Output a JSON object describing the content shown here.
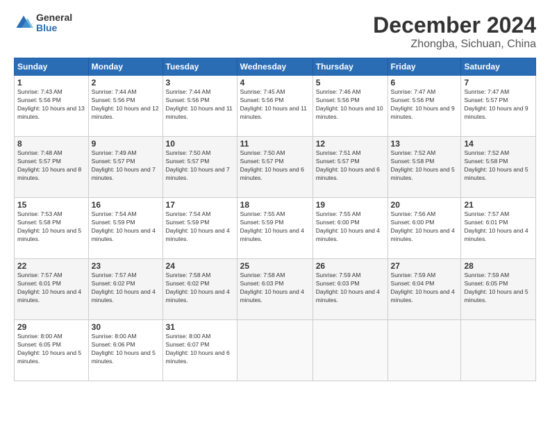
{
  "logo": {
    "general": "General",
    "blue": "Blue"
  },
  "title": "December 2024",
  "location": "Zhongba, Sichuan, China",
  "days_of_week": [
    "Sunday",
    "Monday",
    "Tuesday",
    "Wednesday",
    "Thursday",
    "Friday",
    "Saturday"
  ],
  "weeks": [
    [
      {
        "day": "1",
        "sunrise": "7:43 AM",
        "sunset": "5:56 PM",
        "daylight": "10 hours and 13 minutes."
      },
      {
        "day": "2",
        "sunrise": "7:44 AM",
        "sunset": "5:56 PM",
        "daylight": "10 hours and 12 minutes."
      },
      {
        "day": "3",
        "sunrise": "7:44 AM",
        "sunset": "5:56 PM",
        "daylight": "10 hours and 11 minutes."
      },
      {
        "day": "4",
        "sunrise": "7:45 AM",
        "sunset": "5:56 PM",
        "daylight": "10 hours and 11 minutes."
      },
      {
        "day": "5",
        "sunrise": "7:46 AM",
        "sunset": "5:56 PM",
        "daylight": "10 hours and 10 minutes."
      },
      {
        "day": "6",
        "sunrise": "7:47 AM",
        "sunset": "5:56 PM",
        "daylight": "10 hours and 9 minutes."
      },
      {
        "day": "7",
        "sunrise": "7:47 AM",
        "sunset": "5:57 PM",
        "daylight": "10 hours and 9 minutes."
      }
    ],
    [
      {
        "day": "8",
        "sunrise": "7:48 AM",
        "sunset": "5:57 PM",
        "daylight": "10 hours and 8 minutes."
      },
      {
        "day": "9",
        "sunrise": "7:49 AM",
        "sunset": "5:57 PM",
        "daylight": "10 hours and 7 minutes."
      },
      {
        "day": "10",
        "sunrise": "7:50 AM",
        "sunset": "5:57 PM",
        "daylight": "10 hours and 7 minutes."
      },
      {
        "day": "11",
        "sunrise": "7:50 AM",
        "sunset": "5:57 PM",
        "daylight": "10 hours and 6 minutes."
      },
      {
        "day": "12",
        "sunrise": "7:51 AM",
        "sunset": "5:57 PM",
        "daylight": "10 hours and 6 minutes."
      },
      {
        "day": "13",
        "sunrise": "7:52 AM",
        "sunset": "5:58 PM",
        "daylight": "10 hours and 5 minutes."
      },
      {
        "day": "14",
        "sunrise": "7:52 AM",
        "sunset": "5:58 PM",
        "daylight": "10 hours and 5 minutes."
      }
    ],
    [
      {
        "day": "15",
        "sunrise": "7:53 AM",
        "sunset": "5:58 PM",
        "daylight": "10 hours and 5 minutes."
      },
      {
        "day": "16",
        "sunrise": "7:54 AM",
        "sunset": "5:59 PM",
        "daylight": "10 hours and 4 minutes."
      },
      {
        "day": "17",
        "sunrise": "7:54 AM",
        "sunset": "5:59 PM",
        "daylight": "10 hours and 4 minutes."
      },
      {
        "day": "18",
        "sunrise": "7:55 AM",
        "sunset": "5:59 PM",
        "daylight": "10 hours and 4 minutes."
      },
      {
        "day": "19",
        "sunrise": "7:55 AM",
        "sunset": "6:00 PM",
        "daylight": "10 hours and 4 minutes."
      },
      {
        "day": "20",
        "sunrise": "7:56 AM",
        "sunset": "6:00 PM",
        "daylight": "10 hours and 4 minutes."
      },
      {
        "day": "21",
        "sunrise": "7:57 AM",
        "sunset": "6:01 PM",
        "daylight": "10 hours and 4 minutes."
      }
    ],
    [
      {
        "day": "22",
        "sunrise": "7:57 AM",
        "sunset": "6:01 PM",
        "daylight": "10 hours and 4 minutes."
      },
      {
        "day": "23",
        "sunrise": "7:57 AM",
        "sunset": "6:02 PM",
        "daylight": "10 hours and 4 minutes."
      },
      {
        "day": "24",
        "sunrise": "7:58 AM",
        "sunset": "6:02 PM",
        "daylight": "10 hours and 4 minutes."
      },
      {
        "day": "25",
        "sunrise": "7:58 AM",
        "sunset": "6:03 PM",
        "daylight": "10 hours and 4 minutes."
      },
      {
        "day": "26",
        "sunrise": "7:59 AM",
        "sunset": "6:03 PM",
        "daylight": "10 hours and 4 minutes."
      },
      {
        "day": "27",
        "sunrise": "7:59 AM",
        "sunset": "6:04 PM",
        "daylight": "10 hours and 4 minutes."
      },
      {
        "day": "28",
        "sunrise": "7:59 AM",
        "sunset": "6:05 PM",
        "daylight": "10 hours and 5 minutes."
      }
    ],
    [
      {
        "day": "29",
        "sunrise": "8:00 AM",
        "sunset": "6:05 PM",
        "daylight": "10 hours and 5 minutes."
      },
      {
        "day": "30",
        "sunrise": "8:00 AM",
        "sunset": "6:06 PM",
        "daylight": "10 hours and 5 minutes."
      },
      {
        "day": "31",
        "sunrise": "8:00 AM",
        "sunset": "6:07 PM",
        "daylight": "10 hours and 6 minutes."
      },
      null,
      null,
      null,
      null
    ]
  ]
}
